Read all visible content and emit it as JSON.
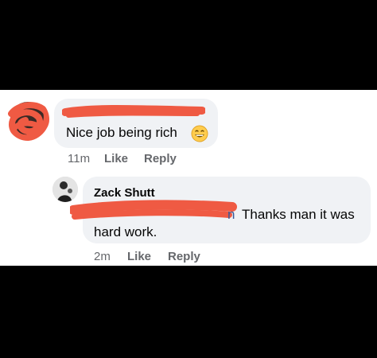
{
  "comments": [
    {
      "text": "Nice job being rich",
      "reaction_emoji_icon": "grinning-face-icon",
      "time": "11m",
      "like_label": "Like",
      "reply_label": "Reply"
    },
    {
      "author": "Zack Shutt",
      "mention_fragment": "n",
      "text_tail": "Thanks man it was",
      "text_line2": "hard work.",
      "time": "2m",
      "like_label": "Like",
      "reply_label": "Reply"
    }
  ],
  "colors": {
    "background": "#000000",
    "panel": "#ffffff",
    "bubble": "#f0f2f5",
    "text": "#050505",
    "meta": "#65676b",
    "mention": "#385898",
    "redaction": "#ef5a43"
  }
}
